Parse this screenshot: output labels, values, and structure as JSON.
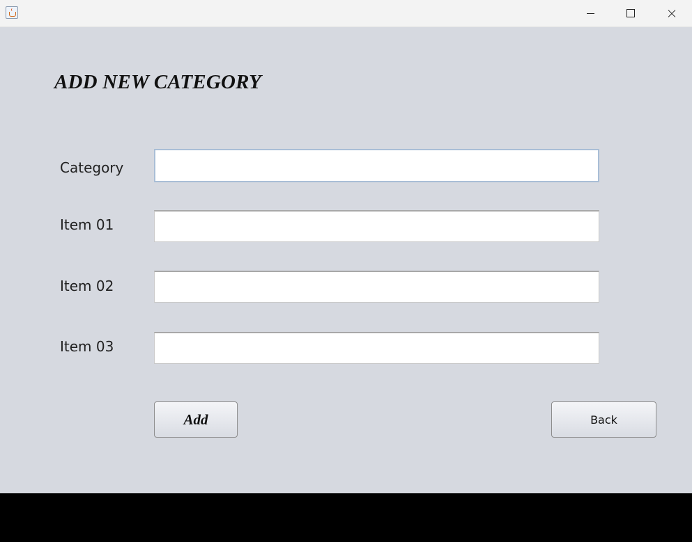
{
  "titlebar": {
    "app_icon": "java-cup-icon",
    "controls": [
      "minimize-icon",
      "maximize-icon",
      "close-icon"
    ]
  },
  "form": {
    "heading": "ADD NEW CATEGORY",
    "fields": [
      {
        "label": "Category",
        "value": "",
        "placeholder": ""
      },
      {
        "label": "Item 01",
        "value": "",
        "placeholder": ""
      },
      {
        "label": "Item 02",
        "value": "",
        "placeholder": ""
      },
      {
        "label": "Item 03",
        "value": "",
        "placeholder": ""
      }
    ],
    "add_label": "Add",
    "back_label": "Back"
  }
}
